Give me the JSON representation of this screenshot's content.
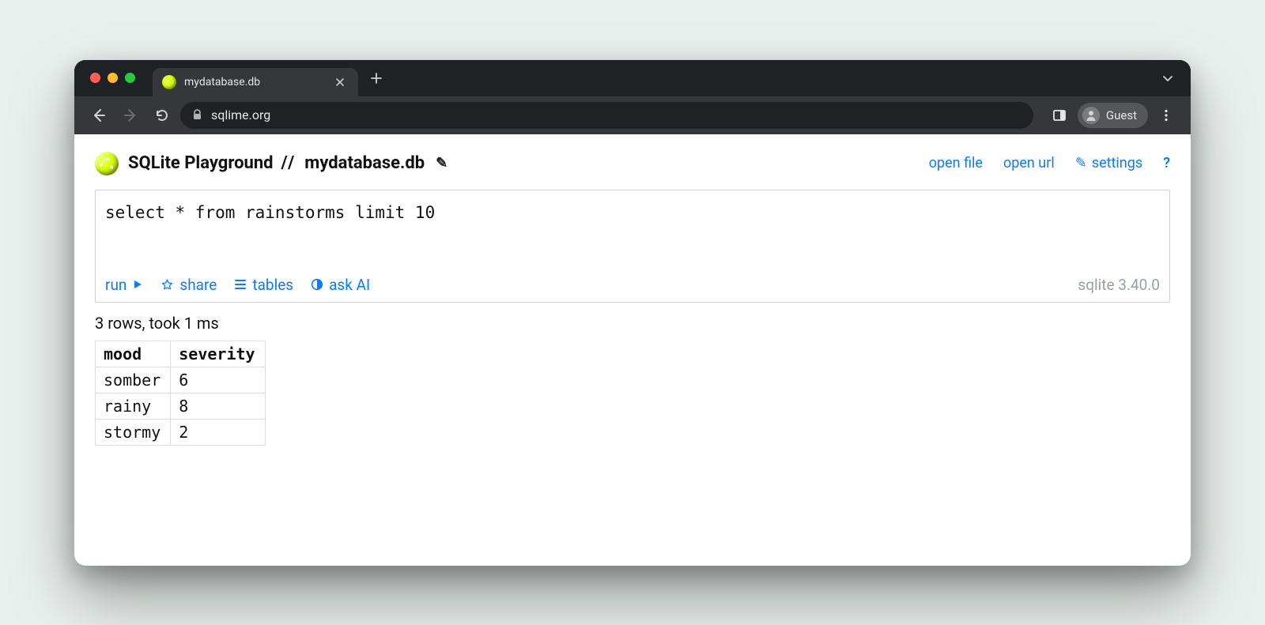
{
  "browser": {
    "tab_title": "mydatabase.db",
    "url": "sqlime.org",
    "profile_label": "Guest"
  },
  "header": {
    "app_name": "SQLite Playground",
    "separator": "//",
    "db_name": "mydatabase.db",
    "actions": {
      "open_file": "open file",
      "open_url": "open url",
      "settings": "settings",
      "help": "?"
    }
  },
  "editor": {
    "query": "select * from rainstorms limit 10",
    "toolbar": {
      "run": "run",
      "share": "share",
      "tables": "tables",
      "ask_ai": "ask AI"
    },
    "version_label": "sqlite 3.40.0"
  },
  "result": {
    "status": "3 rows, took 1 ms",
    "columns": [
      "mood",
      "severity"
    ],
    "rows": [
      [
        "somber",
        "6"
      ],
      [
        "rainy",
        "8"
      ],
      [
        "stormy",
        "2"
      ]
    ]
  }
}
